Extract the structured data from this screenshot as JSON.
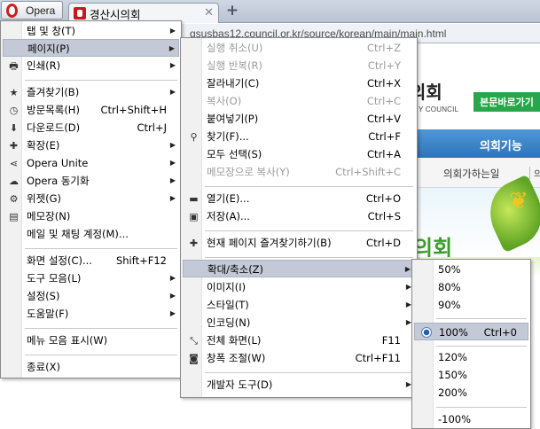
{
  "browser": {
    "menu_button_label": "Opera",
    "tab_title": "경산시의회",
    "tab_close_glyph": "✕",
    "new_tab_glyph": "+",
    "address": "gsusbas12.council.or.kr/source/korean/main/main.html"
  },
  "page": {
    "logo_text": "의회",
    "logo_subtext": "Y COUNCIL",
    "skip_button": "본문바로가기",
    "nav_label": "의회기능",
    "subnav_item": "의회가하는일",
    "subnav_more": "의",
    "banner_text": "의회"
  },
  "main_menu": {
    "items": [
      {
        "label": "탭 및 창(T)",
        "icon": "",
        "shortcut": ""
      },
      {
        "label": "페이지(P)",
        "icon": "",
        "shortcut": ""
      },
      {
        "label": "인쇄(R)",
        "icon": "print-icon",
        "shortcut": ""
      },
      {
        "label": "즐겨찾기(B)",
        "icon": "star-icon",
        "shortcut": ""
      },
      {
        "label": "방문목록(H)",
        "icon": "history-clock-icon",
        "shortcut": "Ctrl+Shift+H"
      },
      {
        "label": "다운로드(D)",
        "icon": "download-icon",
        "shortcut": "Ctrl+J"
      },
      {
        "label": "확장(E)",
        "icon": "puzzle-extension-icon",
        "shortcut": ""
      },
      {
        "label": "Opera Unite",
        "icon": "unite-share-icon",
        "shortcut": ""
      },
      {
        "label": "Opera 동기화",
        "icon": "cloud-sync-icon",
        "shortcut": ""
      },
      {
        "label": "위젯(G)",
        "icon": "widget-gear-icon",
        "shortcut": ""
      },
      {
        "label": "메모장(N)",
        "icon": "notes-icon",
        "shortcut": ""
      },
      {
        "label": "메일 및 채팅 계정(M)...",
        "icon": "",
        "shortcut": ""
      },
      {
        "label": "화면 설정(C)...",
        "icon": "",
        "shortcut": "Shift+F12"
      },
      {
        "label": "도구 모음(L)",
        "icon": "",
        "shortcut": ""
      },
      {
        "label": "설정(S)",
        "icon": "",
        "shortcut": ""
      },
      {
        "label": "도움말(F)",
        "icon": "",
        "shortcut": ""
      },
      {
        "label": "메뉴 모음 표시(W)",
        "icon": "",
        "shortcut": ""
      },
      {
        "label": "종료(X)",
        "icon": "",
        "shortcut": ""
      }
    ]
  },
  "page_menu": {
    "items": [
      {
        "label": "실행 취소(U)",
        "shortcut": "Ctrl+Z"
      },
      {
        "label": "실행 반복(R)",
        "shortcut": "Ctrl+Y"
      },
      {
        "label": "잘라내기(C)",
        "shortcut": "Ctrl+X"
      },
      {
        "label": "복사(O)",
        "shortcut": "Ctrl+C"
      },
      {
        "label": "붙여넣기(P)",
        "shortcut": "Ctrl+V"
      },
      {
        "label": "찾기(F)...",
        "shortcut": "Ctrl+F"
      },
      {
        "label": "모두 선택(S)",
        "shortcut": "Ctrl+A"
      },
      {
        "label": "메모장으로 복사(Y)",
        "shortcut": "Ctrl+Shift+C"
      },
      {
        "label": "열기(E)...",
        "shortcut": "Ctrl+O"
      },
      {
        "label": "저장(A)...",
        "shortcut": "Ctrl+S"
      },
      {
        "label": "현재 페이지 즐겨찾기하기(B)",
        "shortcut": "Ctrl+D"
      },
      {
        "label": "확대/축소(Z)",
        "shortcut": ""
      },
      {
        "label": "이미지(I)",
        "shortcut": ""
      },
      {
        "label": "스타일(T)",
        "shortcut": ""
      },
      {
        "label": "인코딩(N)",
        "shortcut": ""
      },
      {
        "label": "전체 화면(L)",
        "shortcut": "F11"
      },
      {
        "label": "창폭 조절(W)",
        "shortcut": "Ctrl+F11"
      },
      {
        "label": "개발자 도구(D)",
        "shortcut": ""
      }
    ]
  },
  "zoom_menu": {
    "items": [
      {
        "label": "50%",
        "shortcut": ""
      },
      {
        "label": "80%",
        "shortcut": ""
      },
      {
        "label": "90%",
        "shortcut": ""
      },
      {
        "label": "100%",
        "shortcut": "Ctrl+0",
        "selected": true
      },
      {
        "label": "120%",
        "shortcut": ""
      },
      {
        "label": "150%",
        "shortcut": ""
      },
      {
        "label": "200%",
        "shortcut": ""
      },
      {
        "label": "-100%",
        "shortcut": ""
      }
    ]
  },
  "colors": {
    "highlight": "#c3c9d6",
    "disabled_text": "#9b9b9b",
    "skip_button_green": "#27a64a",
    "nav_blue": "#2f73b9",
    "opera_red": "#cc1f1f"
  }
}
